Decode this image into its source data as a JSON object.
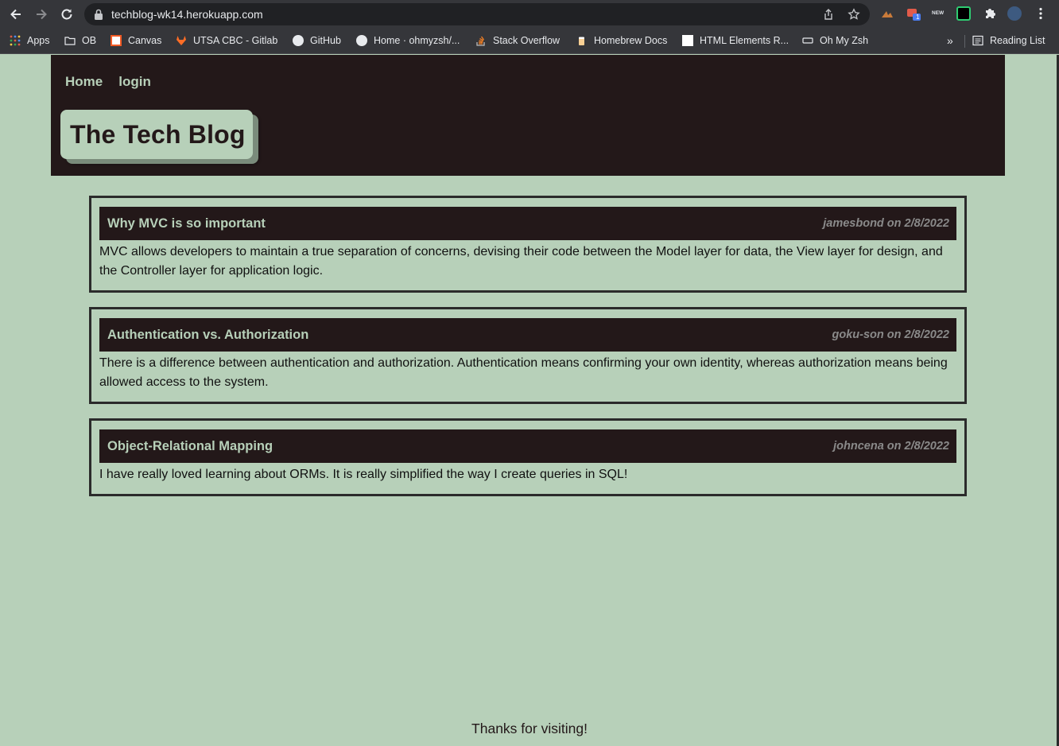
{
  "browser": {
    "url": "techblog-wk14.herokuapp.com",
    "bookmarks": [
      {
        "label": "Apps"
      },
      {
        "label": "OB"
      },
      {
        "label": "Canvas"
      },
      {
        "label": "UTSA CBC - Gitlab"
      },
      {
        "label": "GitHub"
      },
      {
        "label": "Home · ohmyzsh/..."
      },
      {
        "label": "Stack Overflow"
      },
      {
        "label": "Homebrew Docs"
      },
      {
        "label": "HTML Elements R..."
      },
      {
        "label": "Oh My Zsh"
      }
    ],
    "more_label": "»",
    "reading_list": "Reading List",
    "ext_badge": "1",
    "ext_new": "NEW"
  },
  "nav": {
    "home": "Home",
    "login": "login"
  },
  "brand": {
    "title": "The Tech Blog"
  },
  "posts": [
    {
      "title": "Why MVC is so important",
      "meta": "jamesbond on 2/8/2022",
      "body": "MVC allows developers to maintain a true separation of concerns, devising their code between the Model layer for data, the View layer for design, and the Controller layer for application logic."
    },
    {
      "title": "Authentication vs. Authorization",
      "meta": "goku-son on 2/8/2022",
      "body": "There is a difference between authentication and authorization. Authentication means confirming your own identity, whereas authorization means being allowed access to the system."
    },
    {
      "title": "Object-Relational Mapping",
      "meta": "johncena on 2/8/2022",
      "body": "I have really loved learning about ORMs. It is really simplified the way I create queries in SQL!"
    }
  ],
  "footer": {
    "text": "Thanks for visiting!"
  },
  "colors": {
    "page_bg": "#b7d0b9",
    "header_bg": "#231819",
    "accent_text": "#b7d0b9"
  }
}
